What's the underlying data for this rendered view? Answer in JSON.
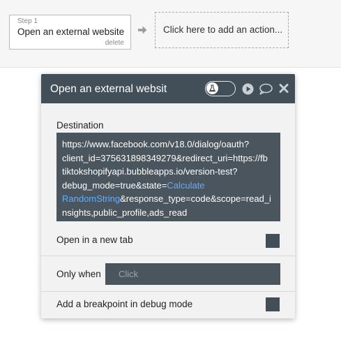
{
  "workflow": {
    "step_label": "Step 1",
    "step_title": "Open an external website",
    "delete_label": "delete",
    "add_action_label": "Click here to add an action..."
  },
  "panel": {
    "title": "Open an external websit",
    "destination": {
      "label": "Destination",
      "line1": "https://www.facebook.com/v18.0/dialog/oauth?",
      "line2": "client_id=375631898349279&redirect_uri=https://fb",
      "line3": "tiktokshopifyapi.bubbleapps.io/version-test?",
      "line4_static": "debug_mode=true&state=",
      "line4_dynamic": "Calculate",
      "line5_dynamic": "RandomString",
      "line5_static": "&response_type=code&scope=read_i",
      "line6": "nsights,public_profile,ads_read"
    },
    "new_tab": {
      "label": "Open in a new tab",
      "checked": false
    },
    "only_when": {
      "label": "Only when",
      "placeholder": "Click"
    },
    "breakpoint": {
      "label": "Add a breakpoint in debug mode",
      "checked": false
    }
  },
  "colors": {
    "header_bg": "#424f59",
    "field_bg": "#4a555e",
    "dynamic_text": "#6aaaf7",
    "panel_bg": "#f2f2f2"
  },
  "icons": {
    "arrow": "arrow-right-icon",
    "toggle": "debug-toggle",
    "play": "play-icon",
    "comment": "comment-icon",
    "close": "close-icon"
  }
}
